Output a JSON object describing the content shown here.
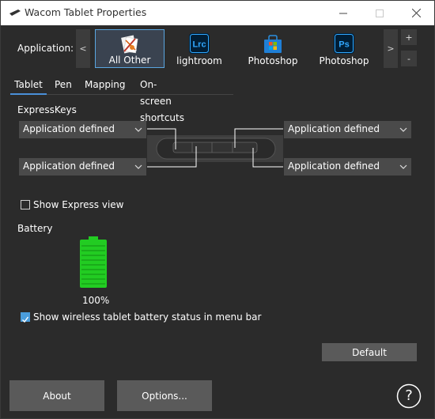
{
  "window": {
    "title": "Wacom Tablet Properties"
  },
  "app_bar": {
    "label": "Application:",
    "scroll_left": "<",
    "scroll_right": ">",
    "add": "+",
    "remove": "-",
    "apps": [
      {
        "label": "All Other",
        "icon": "all-other-icon",
        "selected": true
      },
      {
        "label": "lightroom",
        "icon": "lightroom-icon",
        "badge": "Lrc"
      },
      {
        "label": "Photoshop",
        "icon": "windows-store-icon"
      },
      {
        "label": "Photoshop",
        "icon": "photoshop-icon",
        "badge": "Ps"
      }
    ]
  },
  "tabs": [
    {
      "label": "Tablet",
      "active": true
    },
    {
      "label": "Pen"
    },
    {
      "label": "Mapping"
    },
    {
      "label": "On-screen shortcuts"
    }
  ],
  "expresskeys": {
    "label": "ExpressKeys",
    "dropdowns": [
      {
        "value": "Application defined"
      },
      {
        "value": "Application defined"
      },
      {
        "value": "Application defined"
      },
      {
        "value": "Application defined"
      }
    ]
  },
  "express_view": {
    "label": "Show Express view",
    "checked": false
  },
  "battery": {
    "label": "Battery",
    "percent_text": "100%",
    "level": 1.0
  },
  "battery_menu": {
    "label": "Show wireless tablet battery status in menu bar",
    "checked": true
  },
  "buttons": {
    "default": "Default",
    "about": "About",
    "options": "Options...",
    "help": "?"
  },
  "colors": {
    "background": "#2b2b2b",
    "accent": "#4a9ddc",
    "battery_green": "#22cc22"
  }
}
